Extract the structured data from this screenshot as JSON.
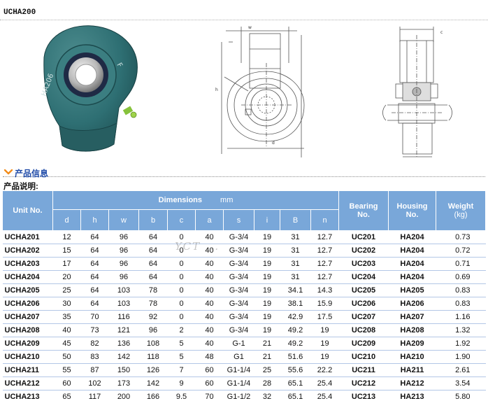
{
  "title": "UCHA200",
  "section_title": "产品信息",
  "description_label": "产品说明:",
  "watermark_text": "YCT ...",
  "table": {
    "unit_header": "Unit No.",
    "dimensions_header": "Dimensions",
    "dimensions_unit": "mm",
    "sub_headers": [
      "d",
      "h",
      "w",
      "b",
      "c",
      "a",
      "s",
      "i",
      "B",
      "n"
    ],
    "bearing_header": [
      "Bearing",
      "No."
    ],
    "housing_header": [
      "Housing",
      "No."
    ],
    "weight_header": [
      "Weight",
      "(kg)"
    ],
    "rows": [
      {
        "unit": "UCHA201",
        "dims": [
          "12",
          "64",
          "96",
          "64",
          "0",
          "40",
          "G-3/4",
          "19",
          "31",
          "12.7"
        ],
        "bearing": "UC201",
        "housing": "HA204",
        "weight": "0.73"
      },
      {
        "unit": "UCHA202",
        "dims": [
          "15",
          "64",
          "96",
          "64",
          "0",
          "40",
          "G-3/4",
          "19",
          "31",
          "12.7"
        ],
        "bearing": "UC202",
        "housing": "HA204",
        "weight": "0.72"
      },
      {
        "unit": "UCHA203",
        "dims": [
          "17",
          "64",
          "96",
          "64",
          "0",
          "40",
          "G-3/4",
          "19",
          "31",
          "12.7"
        ],
        "bearing": "UC203",
        "housing": "HA204",
        "weight": "0.71"
      },
      {
        "unit": "UCHA204",
        "dims": [
          "20",
          "64",
          "96",
          "64",
          "0",
          "40",
          "G-3/4",
          "19",
          "31",
          "12.7"
        ],
        "bearing": "UC204",
        "housing": "HA204",
        "weight": "0.69"
      },
      {
        "unit": "UCHA205",
        "dims": [
          "25",
          "64",
          "103",
          "78",
          "0",
          "40",
          "G-3/4",
          "19",
          "34.1",
          "14.3"
        ],
        "bearing": "UC205",
        "housing": "HA205",
        "weight": "0.83"
      },
      {
        "unit": "UCHA206",
        "dims": [
          "30",
          "64",
          "103",
          "78",
          "0",
          "40",
          "G-3/4",
          "19",
          "38.1",
          "15.9"
        ],
        "bearing": "UC206",
        "housing": "HA206",
        "weight": "0.83"
      },
      {
        "unit": "UCHA207",
        "dims": [
          "35",
          "70",
          "116",
          "92",
          "0",
          "40",
          "G-3/4",
          "19",
          "42.9",
          "17.5"
        ],
        "bearing": "UC207",
        "housing": "HA207",
        "weight": "1.16"
      },
      {
        "unit": "UCHA208",
        "dims": [
          "40",
          "73",
          "121",
          "96",
          "2",
          "40",
          "G-3/4",
          "19",
          "49.2",
          "19"
        ],
        "bearing": "UC208",
        "housing": "HA208",
        "weight": "1.32"
      },
      {
        "unit": "UCHA209",
        "dims": [
          "45",
          "82",
          "136",
          "108",
          "5",
          "40",
          "G-1",
          "21",
          "49.2",
          "19"
        ],
        "bearing": "UC209",
        "housing": "HA209",
        "weight": "1.92"
      },
      {
        "unit": "UCHA210",
        "dims": [
          "50",
          "83",
          "142",
          "118",
          "5",
          "48",
          "G1",
          "21",
          "51.6",
          "19"
        ],
        "bearing": "UC210",
        "housing": "HA210",
        "weight": "1.90"
      },
      {
        "unit": "UCHA211",
        "dims": [
          "55",
          "87",
          "150",
          "126",
          "7",
          "60",
          "G1-1/4",
          "25",
          "55.6",
          "22.2"
        ],
        "bearing": "UC211",
        "housing": "HA211",
        "weight": "2.61"
      },
      {
        "unit": "UCHA212",
        "dims": [
          "60",
          "102",
          "173",
          "142",
          "9",
          "60",
          "G1-1/4",
          "28",
          "65.1",
          "25.4"
        ],
        "bearing": "UC212",
        "housing": "HA212",
        "weight": "3.54"
      },
      {
        "unit": "UCHA213",
        "dims": [
          "65",
          "117",
          "200",
          "166",
          "9.5",
          "70",
          "G1-1/2",
          "32",
          "65.1",
          "25.4"
        ],
        "bearing": "UC213",
        "housing": "HA213",
        "weight": "5.80"
      }
    ]
  },
  "colors": {
    "header_bg": "#79a7d9",
    "accent_blue": "#1f4ba8",
    "housing_green": "#2e6f73",
    "grease_nipple": "#86c23b"
  }
}
